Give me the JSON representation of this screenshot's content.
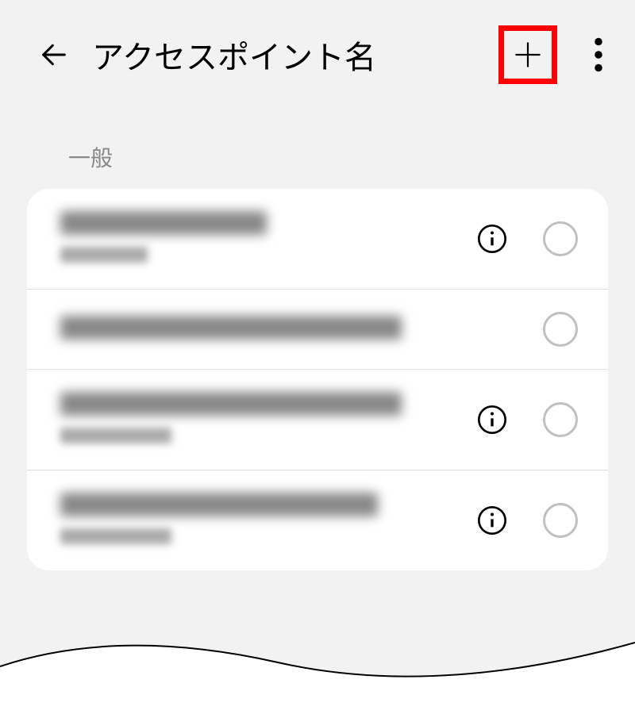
{
  "header": {
    "title": "アクセスポイント名"
  },
  "section": {
    "label": "一般"
  },
  "apn_list": [
    {
      "title_redacted": true,
      "subtitle_redacted": true,
      "has_info": true
    },
    {
      "title_redacted": true,
      "subtitle_redacted": false,
      "has_info": false
    },
    {
      "title_redacted": true,
      "subtitle_redacted": true,
      "has_info": true
    },
    {
      "title_redacted": true,
      "subtitle_redacted": true,
      "has_info": true
    }
  ],
  "annotation": {
    "highlight_add_button": true,
    "highlight_color": "#ff0000"
  }
}
